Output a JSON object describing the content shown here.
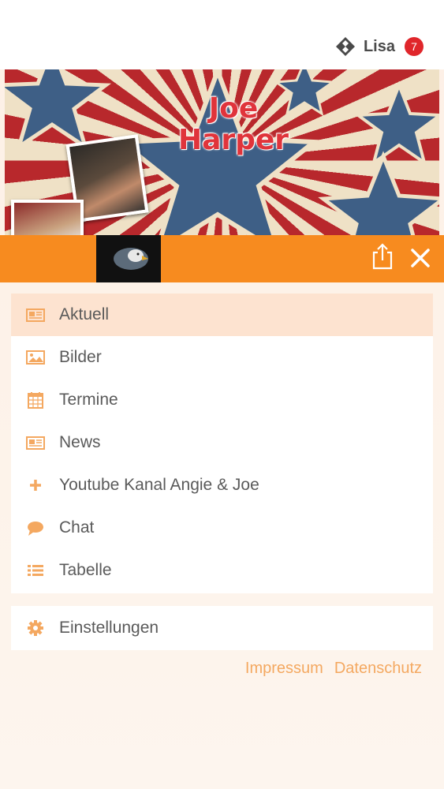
{
  "header": {
    "user_name": "Lisa",
    "notification_count": "7"
  },
  "banner": {
    "title_line1": "Joe",
    "title_line2": "Harper",
    "eagle_thumb_top": "",
    "eagle_thumb_bottom": ""
  },
  "menu": {
    "items": [
      {
        "label": "Aktuell",
        "icon": "newspaper-icon",
        "active": true
      },
      {
        "label": "Bilder",
        "icon": "image-icon",
        "active": false
      },
      {
        "label": "Termine",
        "icon": "calendar-icon",
        "active": false
      },
      {
        "label": "News",
        "icon": "newspaper-icon",
        "active": false
      },
      {
        "label": "Youtube Kanal Angie & Joe",
        "icon": "plus-icon",
        "active": false
      },
      {
        "label": "Chat",
        "icon": "chat-bubble-icon",
        "active": false
      },
      {
        "label": "Tabelle",
        "icon": "list-icon",
        "active": false
      }
    ],
    "settings_label": "Einstellungen"
  },
  "footer": {
    "impressum": "Impressum",
    "datenschutz": "Datenschutz"
  },
  "colors": {
    "accent": "#f78b1f",
    "icon": "#f4a860",
    "active_bg": "#fde3d0",
    "badge": "#e0262b"
  }
}
